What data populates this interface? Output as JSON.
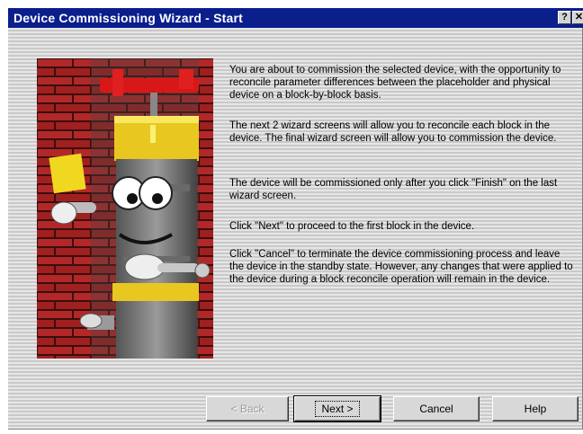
{
  "window": {
    "title": "Device Commissioning Wizard - Start",
    "help_glyph": "?",
    "close_glyph": "✕"
  },
  "messages": [
    "You are about to commission the selected device, with the opportunity to reconcile parameter differences between the placeholder and physical device on a block-by-block basis.",
    "The next 2 wizard screens will allow you to reconcile each block in the device. The final wizard screen will allow you to commission the device.",
    "The device will be commissioned only after you click \"Finish\" on the last wizard screen.",
    "Click \"Next\" to proceed to the first block in the device.",
    "Click \"Cancel\" to terminate the device commissioning process and leave the device in the standby state. However, any changes that were applied to the device during a block reconcile operation will remain in the device."
  ],
  "buttons": {
    "back": "< Back",
    "next": "Next >",
    "cancel": "Cancel",
    "help": "Help"
  },
  "icons": {
    "help": "question-icon",
    "close": "close-icon",
    "illustration": "device-mascot-illustration"
  }
}
